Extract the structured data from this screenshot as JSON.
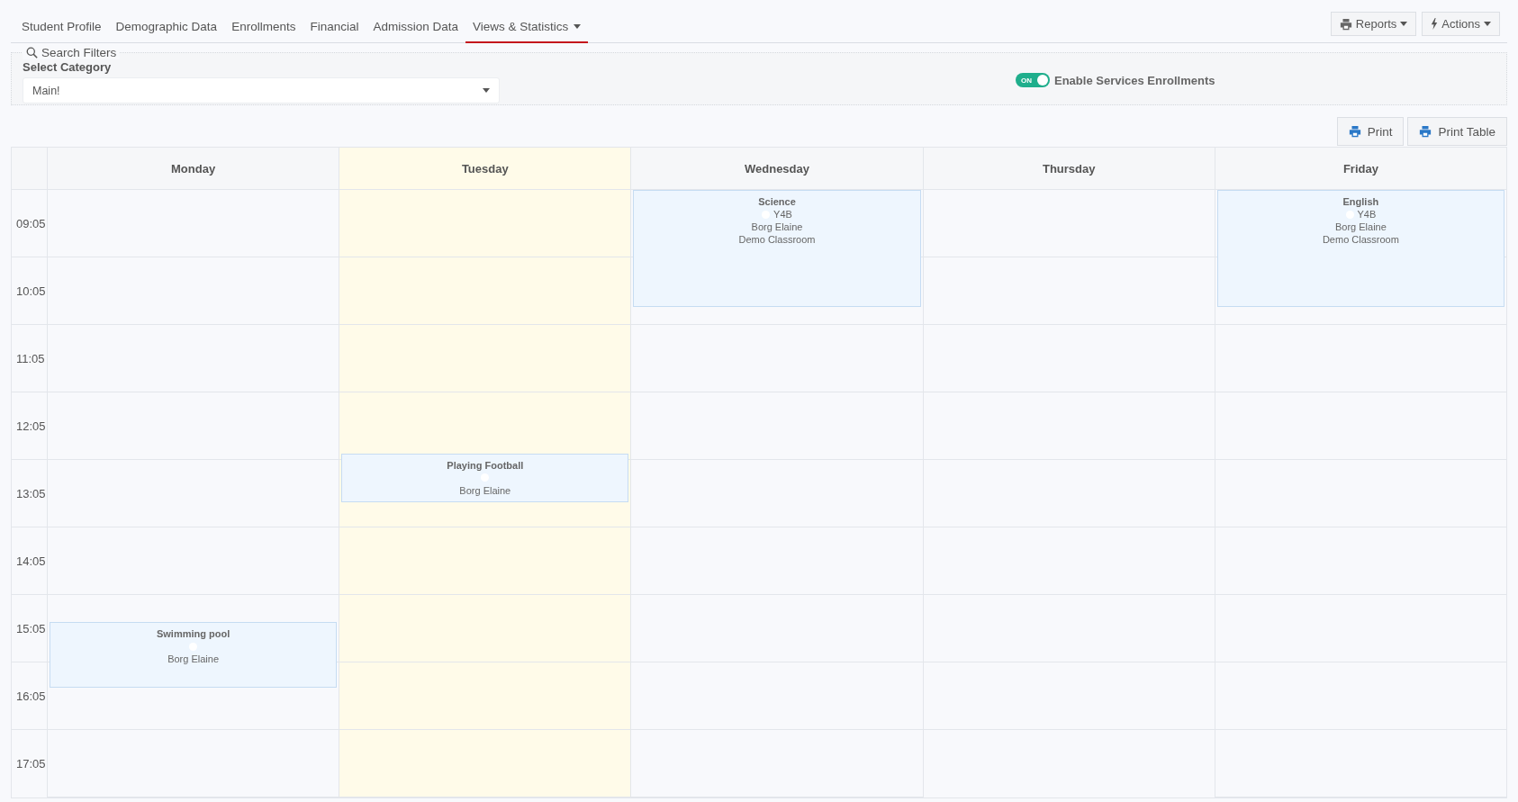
{
  "tabs": [
    {
      "label": "Student Profile",
      "selected": false,
      "dropdown": false
    },
    {
      "label": "Demographic Data",
      "selected": false,
      "dropdown": false
    },
    {
      "label": "Enrollments",
      "selected": false,
      "dropdown": false
    },
    {
      "label": "Financial",
      "selected": false,
      "dropdown": false
    },
    {
      "label": "Admission Data",
      "selected": false,
      "dropdown": false
    },
    {
      "label": "Views & Statistics",
      "selected": true,
      "dropdown": true
    }
  ],
  "header_buttons": [
    {
      "kind": "printer",
      "label": "Reports"
    },
    {
      "kind": "bolt",
      "label": "Actions"
    }
  ],
  "filters": {
    "legend": "Search Filters",
    "category_label": "Select Category",
    "category_value": "Main!",
    "toggle": {
      "on": true,
      "text": "ON",
      "label": "Enable Services Enrollments"
    }
  },
  "print_buttons": [
    "Print",
    "Print Table"
  ],
  "schedule": {
    "times": [
      "09:05",
      "10:05",
      "11:05",
      "12:05",
      "13:05",
      "14:05",
      "15:05",
      "16:05",
      "17:05"
    ],
    "days": [
      {
        "name": "Monday",
        "today": false,
        "events": [
          {
            "title": "Swimming pool",
            "teacher": "Borg Elaine"
          }
        ]
      },
      {
        "name": "Tuesday",
        "today": true,
        "events": [
          {
            "title": "Playing Football",
            "teacher": "Borg Elaine"
          }
        ]
      },
      {
        "name": "Wednesday",
        "today": false,
        "events": [
          {
            "title": "Science",
            "group": "Y4B",
            "teacher": "Borg Elaine",
            "room": "Demo Classroom"
          }
        ]
      },
      {
        "name": "Thursday",
        "today": false
      },
      {
        "name": "Friday",
        "today": false,
        "events": [
          {
            "title": "English",
            "group": "Y4B",
            "teacher": "Borg Elaine",
            "room": "Demo Classroom"
          }
        ]
      }
    ]
  }
}
